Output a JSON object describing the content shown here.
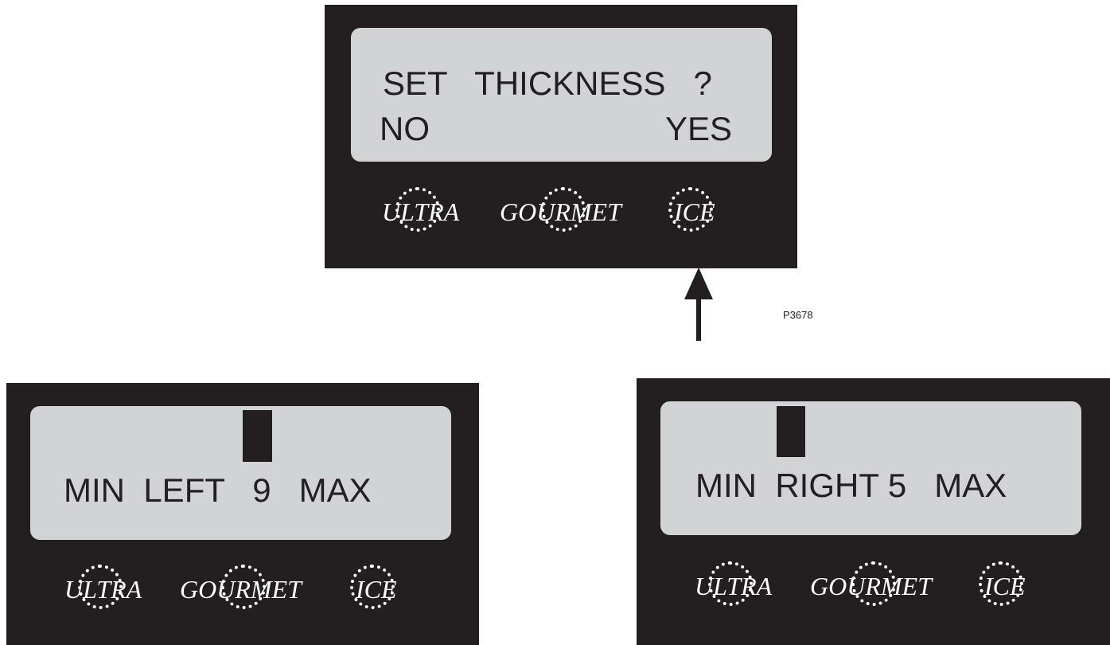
{
  "top_panel": {
    "line1": "SET   THICKNESS   ?",
    "no_label": "NO",
    "yes_label": "YES",
    "buttons": [
      "ULTRA",
      "GOURMET",
      "ICE"
    ]
  },
  "left_panel": {
    "display": "MIN  LEFT   9   MAX",
    "buttons": [
      "ULTRA",
      "GOURMET",
      "ICE"
    ]
  },
  "right_panel": {
    "display": "MIN  RIGHT 5   MAX",
    "buttons": [
      "ULTRA",
      "GOURMET",
      "ICE"
    ]
  },
  "figure_code": "P3678",
  "colors": {
    "panel": "#231f20",
    "lcd": "#d1d3d4",
    "button_text": "#ffffff"
  }
}
